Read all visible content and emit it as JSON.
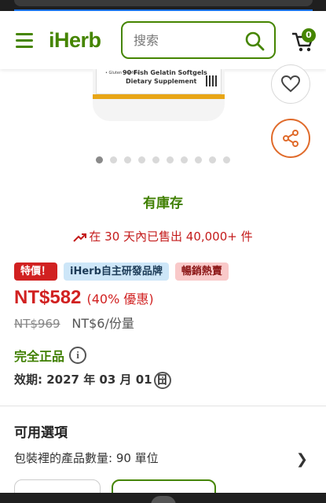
{
  "header": {
    "logo_text": "iHerb",
    "search_placeholder": "搜索",
    "cart_count": "0",
    "accent_color": "#458500"
  },
  "product_image": {
    "line1": "90 Fish Gelatin Softgels",
    "line2": "Dietary Supplement",
    "side_text": "• Gluten • GMOs"
  },
  "carousel": {
    "total": 10,
    "active_index": 0
  },
  "stock": {
    "label": "有庫存"
  },
  "sales": {
    "text": "在 30 天內已售出 40,000+ 件"
  },
  "badges": [
    "特價！",
    "iHerb自主研發品牌",
    "暢銷熱賣"
  ],
  "price": {
    "current": "NT$582",
    "discount": "(40% 優惠)",
    "original": "NT$969",
    "per_unit": "NT$6/份量"
  },
  "details": {
    "genuine": "完全正品",
    "expiry": "效期: 2027 年 03 月 01 日"
  },
  "options": {
    "title": "可用選項",
    "package_label": "包裝裡的產品數量: 90 單位"
  }
}
